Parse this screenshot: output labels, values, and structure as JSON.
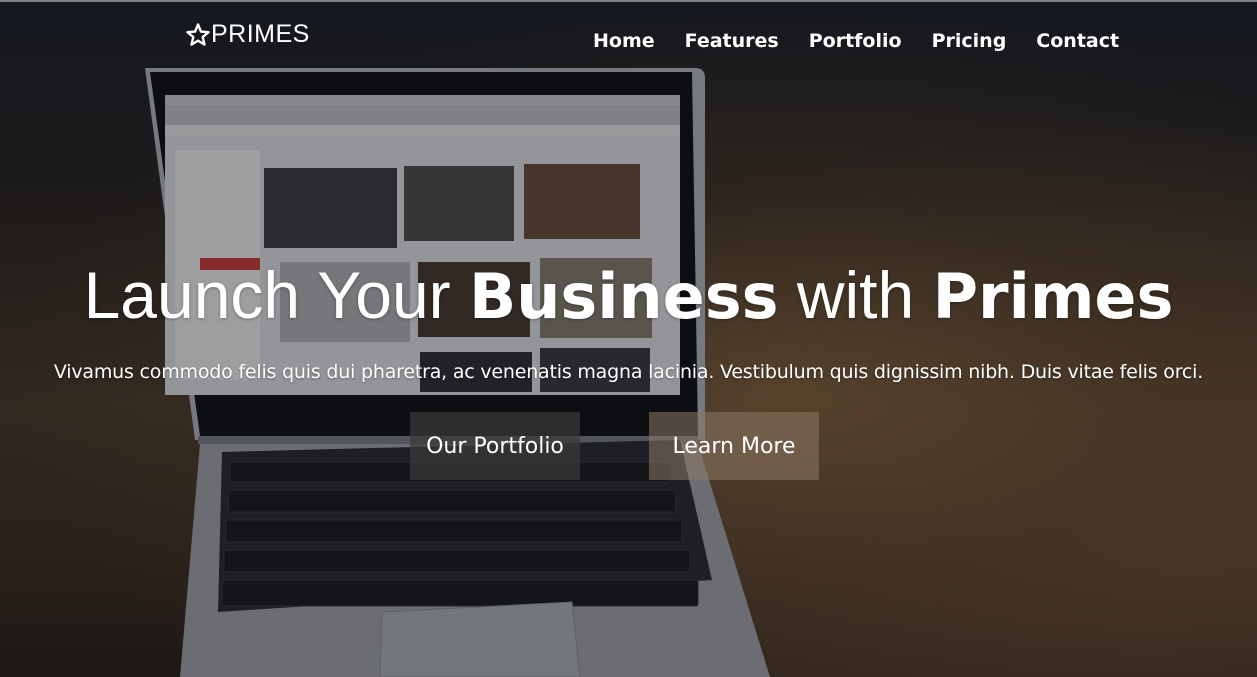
{
  "brand": {
    "name": "PRIMES",
    "icon": "star-icon"
  },
  "nav": {
    "items": [
      {
        "label": "Home"
      },
      {
        "label": "Features"
      },
      {
        "label": "Portfolio"
      },
      {
        "label": "Pricing"
      },
      {
        "label": "Contact"
      }
    ]
  },
  "hero": {
    "headline_part1": "Launch Your ",
    "headline_bold1": "Business",
    "headline_part2": " with ",
    "headline_bold2": "Primes",
    "subtitle": "Vivamus commodo felis quis dui pharetra, ac venenatis magna lacinia. Vestibulum quis dignissim nibh. Duis vitae felis orci.",
    "primary_button": "Our Portfolio",
    "secondary_button": "Learn More"
  },
  "colors": {
    "text": "#ffffff",
    "background": "#2a2520"
  }
}
